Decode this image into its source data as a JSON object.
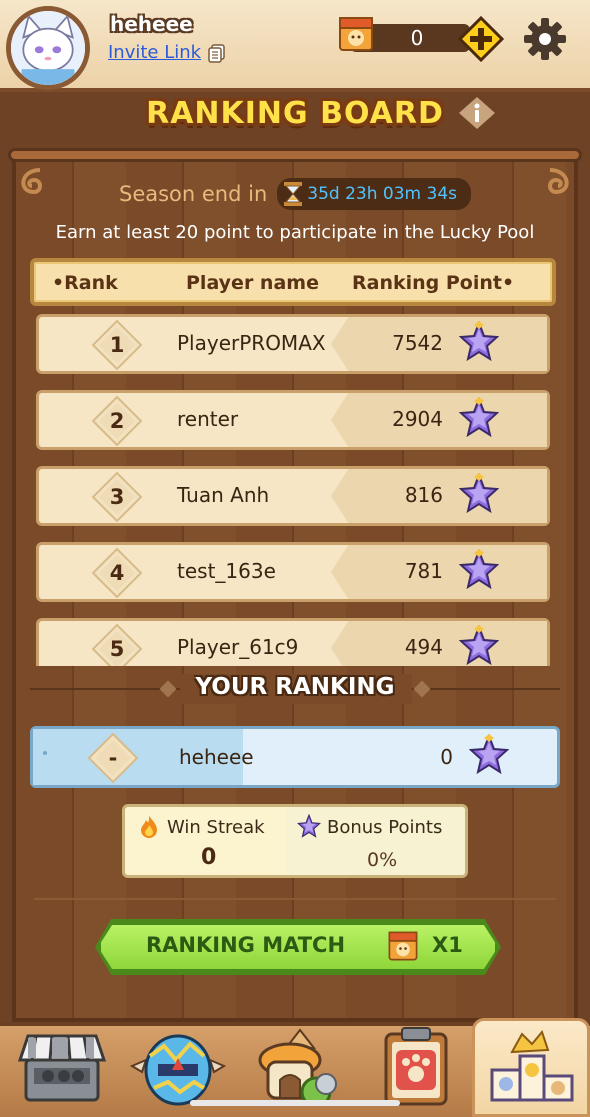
{
  "header": {
    "username": "heheee",
    "invite_label": "Invite Link",
    "ticket_count": "0"
  },
  "title": "RANKING BOARD",
  "season": {
    "label": "Season end in",
    "timer": "35d 23h 03m 34s"
  },
  "notice": "Earn at least 20 point to participate in the Lucky Pool",
  "table_headers": {
    "rank": "•Rank",
    "name": "Player name",
    "point": "Ranking Point•"
  },
  "rows": [
    {
      "rank": "1",
      "name": "PlayerPROMAX",
      "points": "7542"
    },
    {
      "rank": "2",
      "name": "renter",
      "points": "2904"
    },
    {
      "rank": "3",
      "name": "Tuan Anh",
      "points": "816"
    },
    {
      "rank": "4",
      "name": "test_163e",
      "points": "781"
    },
    {
      "rank": "5",
      "name": "Player_61c9",
      "points": "494"
    }
  ],
  "your_ranking": {
    "title": "YOUR RANKING",
    "rank": "-",
    "name": "heheee",
    "points": "0"
  },
  "stats": {
    "win_streak_label": "Win Streak",
    "win_streak_value": "0",
    "bonus_label": "Bonus Points",
    "bonus_value": "0%"
  },
  "match_button": {
    "label": "RANKING MATCH",
    "count": "X1"
  },
  "nav": {
    "items": [
      "shop-icon",
      "egg-icon",
      "house-icon",
      "clipboard-icon",
      "podium-icon"
    ],
    "active": "podium-icon"
  },
  "colors": {
    "title": "#ffe14a",
    "timer": "#4fc3ff",
    "match_button": "#a6e64e",
    "invite_link": "#2a5bd8"
  }
}
